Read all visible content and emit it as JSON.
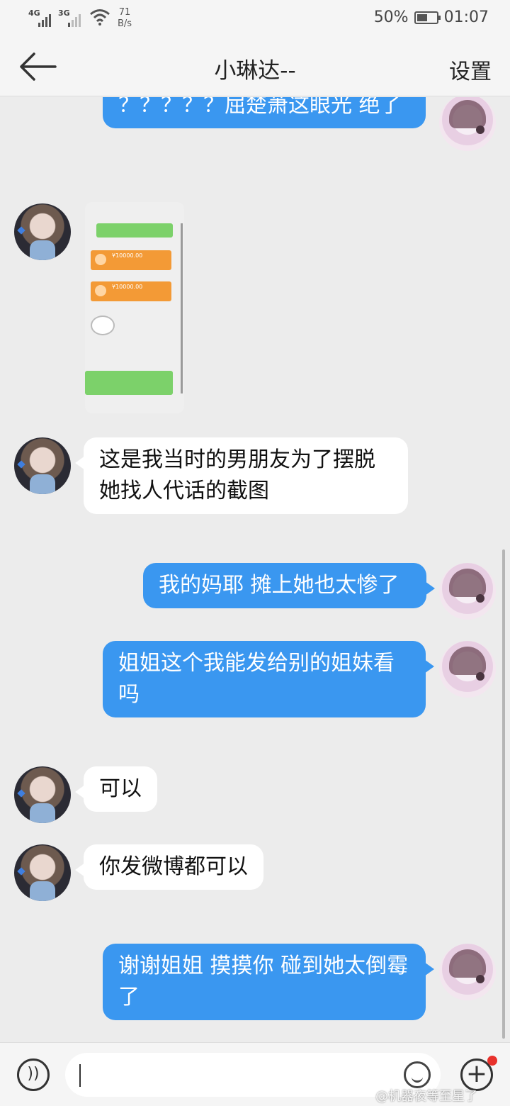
{
  "status_bar": {
    "network_1": "4G",
    "network_2": "3G",
    "speed_value": "71",
    "speed_unit": "B/s",
    "battery": "50%",
    "time": "01:07"
  },
  "header": {
    "title": "小琳达--",
    "settings_label": "设置"
  },
  "messages": [
    {
      "side": "out",
      "text": "？？？？？屈楚萧这眼光 绝了"
    },
    {
      "side": "in",
      "type": "image",
      "text": ""
    },
    {
      "side": "in",
      "text": "这是我当时的男朋友为了摆脱她找人代话的截图"
    },
    {
      "side": "out",
      "text": "我的妈耶 摊上她也太惨了"
    },
    {
      "side": "out",
      "text": "姐姐这个我能发给别的姐妹看吗"
    },
    {
      "side": "in",
      "text": "可以"
    },
    {
      "side": "in",
      "text": "你发微博都可以"
    },
    {
      "side": "out",
      "text": "谢谢姐姐 摸摸你 碰到她太倒霉了"
    }
  ],
  "screenshot_image": {
    "amount_1": "¥10000.00",
    "amount_2": "¥10000.00"
  },
  "input_bar": {
    "placeholder": ""
  },
  "watermark": "@机器夜等至星了",
  "colors": {
    "accent": "#3a97f0",
    "background": "#ececec",
    "badge": "#e8322c"
  }
}
